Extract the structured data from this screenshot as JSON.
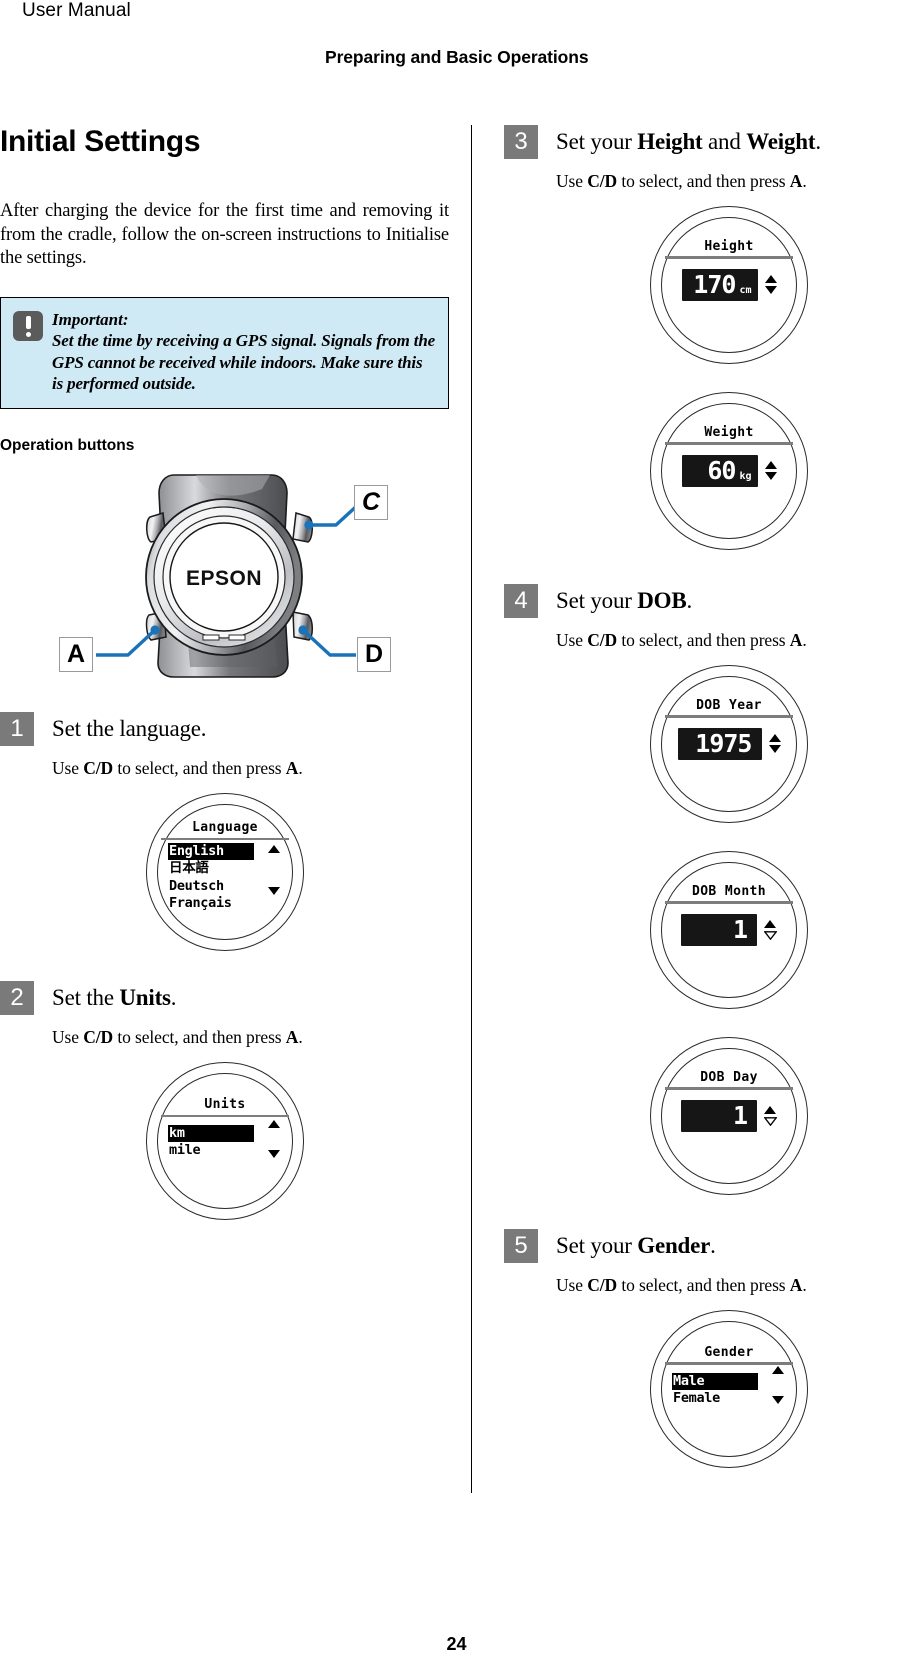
{
  "header": {
    "manual_title": "User Manual",
    "section_title": "Preparing and Basic Operations"
  },
  "footer": {
    "page_number": "24"
  },
  "left_column": {
    "chapter_heading": "Initial Settings",
    "intro_paragraph": "After charging the device for the first time and removing it from the cradle, follow the on-screen instructions to Initialise the settings.",
    "callout": {
      "icon": "important-exclamation-icon",
      "label": "Important:",
      "text": "Set the time by receiving a GPS signal. Signals from the GPS cannot be received while indoors. Make sure this is performed outside.",
      "background_color": "#cfe9f5",
      "border_color": "#000000",
      "icon_color": "#5b5b5b"
    },
    "operation_buttons_heading": "Operation buttons",
    "watch_diagram": {
      "brand_text": "EPSON",
      "callout_labels": [
        {
          "id": "C",
          "label": "C",
          "position": "top-right"
        },
        {
          "id": "A",
          "label": "A",
          "position": "bottom-left"
        },
        {
          "id": "D",
          "label": "D",
          "position": "bottom-right"
        }
      ],
      "leader_line_color": "#1a72b8"
    },
    "steps": [
      {
        "number": "1",
        "title_parts": [
          {
            "text": "Set the language.",
            "bold": false
          }
        ],
        "title_plain": "Set the language.",
        "instruction_plain": "Use C/D to select, and then press A.",
        "screen": {
          "type": "list",
          "title": "Language",
          "items": [
            {
              "label": "English",
              "selected": true
            },
            {
              "label": "日本語",
              "selected": false
            },
            {
              "label": "Deutsch",
              "selected": false
            },
            {
              "label": "Français",
              "selected": false
            }
          ],
          "arrow_up": "filled",
          "arrow_down": "filled"
        }
      },
      {
        "number": "2",
        "title_plain": "Set the Units.",
        "title_prefix": "Set the ",
        "title_bold": "Units",
        "title_suffix": ".",
        "instruction_plain": "Use C/D to select, and then press A.",
        "screen": {
          "type": "list",
          "title": "Units",
          "items": [
            {
              "label": "km",
              "selected": true
            },
            {
              "label": "mile",
              "selected": false
            }
          ],
          "arrow_up": "filled",
          "arrow_down": "filled"
        }
      }
    ]
  },
  "right_column": {
    "steps": [
      {
        "number": "3",
        "title_plain": "Set your Height and Weight.",
        "title_prefix": "Set your ",
        "title_bold": "Height",
        "title_mid": " and ",
        "title_bold2": "Weight",
        "title_suffix": ".",
        "instruction_plain": "Use C/D to select, and then press A.",
        "screens": [
          {
            "type": "value",
            "title": "Height",
            "value": "170",
            "unit": "cm",
            "arrow_up": "filled",
            "arrow_down": "filled"
          },
          {
            "type": "value",
            "title": "Weight",
            "value": "60",
            "unit": "kg",
            "arrow_up": "filled",
            "arrow_down": "filled"
          }
        ]
      },
      {
        "number": "4",
        "title_plain": "Set your DOB.",
        "title_prefix": "Set your ",
        "title_bold": "DOB",
        "title_suffix": ".",
        "instruction_plain": "Use C/D to select, and then press A.",
        "screens": [
          {
            "type": "value",
            "title": "DOB Year",
            "value": "1975",
            "unit": "",
            "arrow_up": "filled",
            "arrow_down": "filled"
          },
          {
            "type": "value",
            "title": "DOB Month",
            "value": "1",
            "unit": "",
            "arrow_up": "filled",
            "arrow_down": "hollow"
          },
          {
            "type": "value",
            "title": "DOB Day",
            "value": "1",
            "unit": "",
            "arrow_up": "filled",
            "arrow_down": "hollow"
          }
        ]
      },
      {
        "number": "5",
        "title_plain": "Set your Gender.",
        "title_prefix": "Set your ",
        "title_bold": "Gender",
        "title_suffix": ".",
        "instruction_plain": "Use C/D to select, and then press A.",
        "screens": [
          {
            "type": "list",
            "title": "Gender",
            "items": [
              {
                "label": "Male",
                "selected": true
              },
              {
                "label": "Female",
                "selected": false
              }
            ],
            "arrow_up": "filled",
            "arrow_down": "filled"
          }
        ]
      }
    ]
  },
  "colors": {
    "callout_bg": "#cfe9f5",
    "step_number_bg": "#7a7a7a",
    "leader_blue": "#1a72b8",
    "lcd_selected_bg": "#000000"
  }
}
